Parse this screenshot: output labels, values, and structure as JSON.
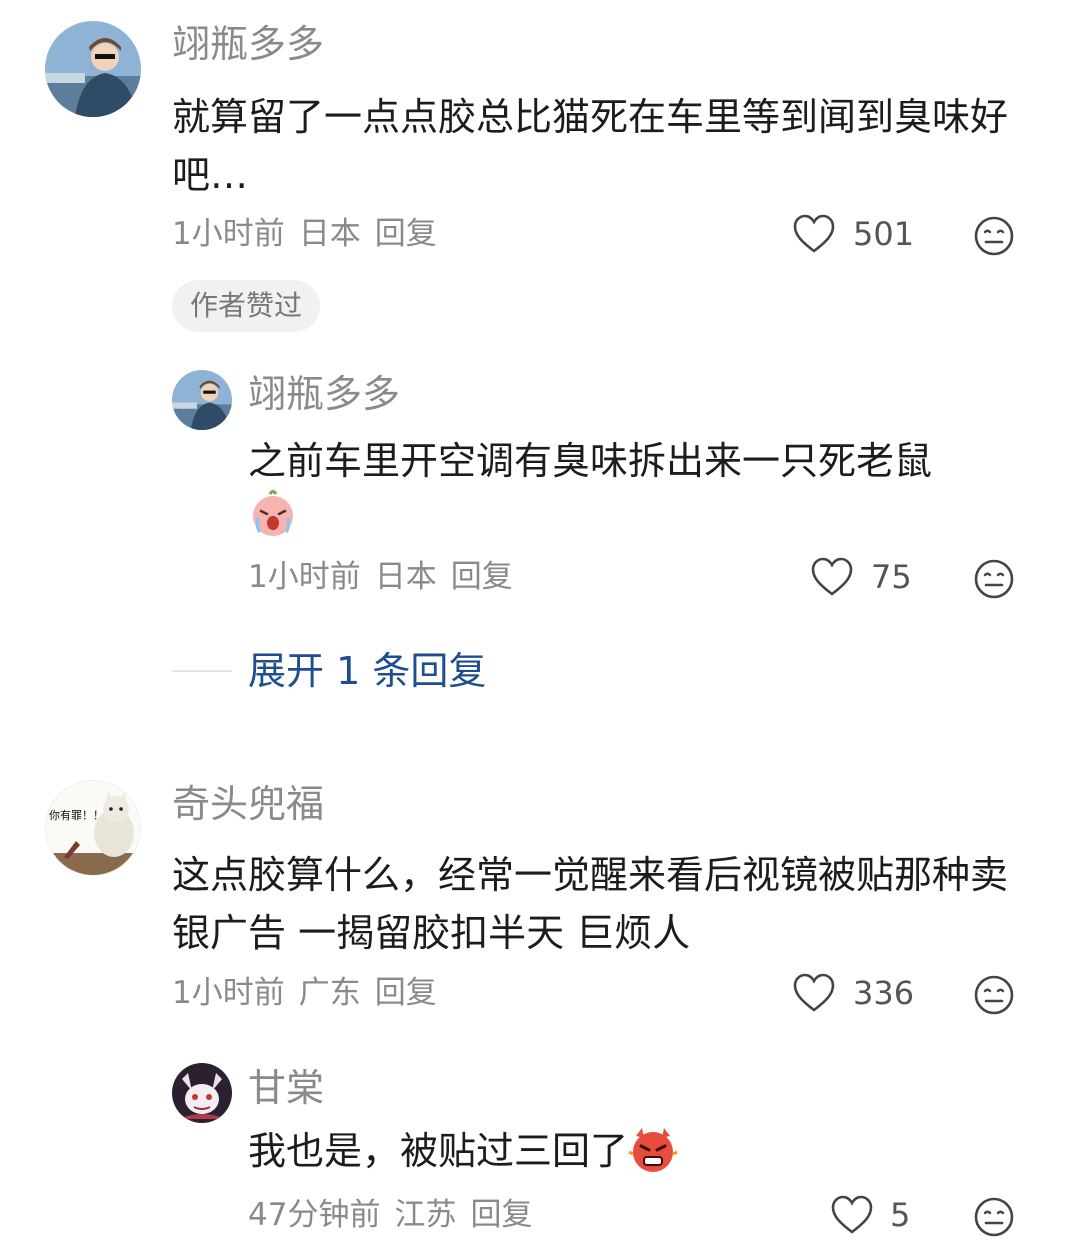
{
  "colors": {
    "text": "#1c1c1c",
    "meta": "#8a8a8a",
    "link": "#1f4d8f",
    "badge_bg": "#f1f1f1"
  },
  "comments": [
    {
      "user": "翊瓶多多",
      "text": "就算留了一点点胶总比猫死在车里等到闻到臭味好吧…",
      "time": "1小时前",
      "location": "日本",
      "reply": "回复",
      "likes": "501",
      "badge": "作者赞过",
      "replies": [
        {
          "user": "翊瓶多多",
          "text": "之前车里开空调有臭味拆出来一只死老鼠",
          "emoji": "crying-face-emoji",
          "time": "1小时前",
          "location": "日本",
          "reply": "回复",
          "likes": "75"
        }
      ],
      "expand_label": "展开 1 条回复"
    },
    {
      "user": "奇头兜福",
      "avatar_caption": "你有罪！！",
      "text": "这点胶算什么，经常一觉醒来看后视镜被贴那种卖银广告 一揭留胶扣半天 巨烦人",
      "time": "1小时前",
      "location": "广东",
      "reply": "回复",
      "likes": "336",
      "replies": [
        {
          "user": "甘棠",
          "text": "我也是，被贴过三回了",
          "emoji": "angry-face-emoji",
          "time": "47分钟前",
          "location": "江苏",
          "reply": "回复",
          "likes": "5"
        }
      ]
    }
  ]
}
